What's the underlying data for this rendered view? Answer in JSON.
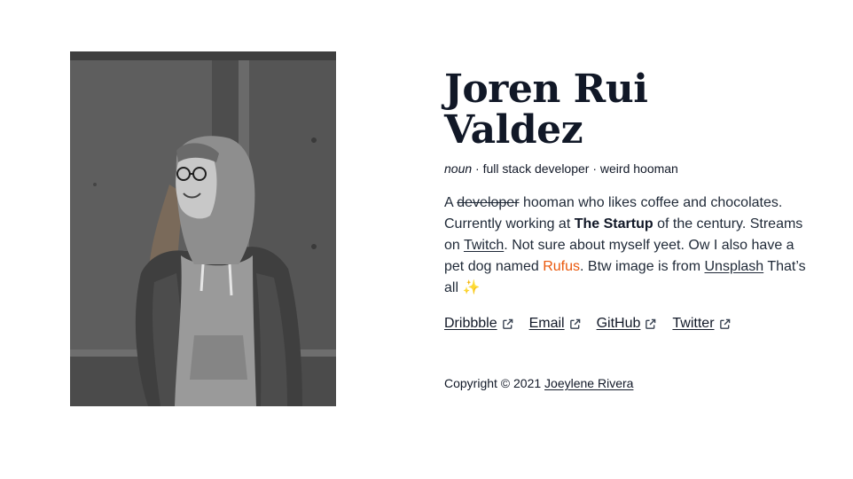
{
  "profile": {
    "name_line1": "Joren Rui",
    "name_line2": "Valdez",
    "pos": "noun",
    "separator": "·",
    "role": "full stack developer",
    "trait": "weird hooman"
  },
  "bio": {
    "a": "A",
    "struck": "developer",
    "p1": "hooman who likes coffee and chocolates. Currently working at",
    "company": "The Startup",
    "p2": "of the century. Streams on",
    "twitch": "Twitch",
    "p3": ". Not sure about myself yeet. Ow I also have a pet dog named",
    "pet": "Rufus",
    "p4": ". Btw image is from",
    "unsplash": "Unsplash",
    "p5": "That’s all",
    "sparkle": "✨"
  },
  "links": [
    {
      "label": "Dribbble",
      "icon": "external-link-icon"
    },
    {
      "label": "Email",
      "icon": "external-link-icon"
    },
    {
      "label": "GitHub",
      "icon": "external-link-icon"
    },
    {
      "label": "Twitter",
      "icon": "external-link-icon"
    }
  ],
  "footer": {
    "copyright": "Copyright © 2021",
    "author": "Joeylene Rivera"
  },
  "colors": {
    "text": "#111827",
    "accent": "#ea580c",
    "sparkle": "#fbbf24"
  }
}
